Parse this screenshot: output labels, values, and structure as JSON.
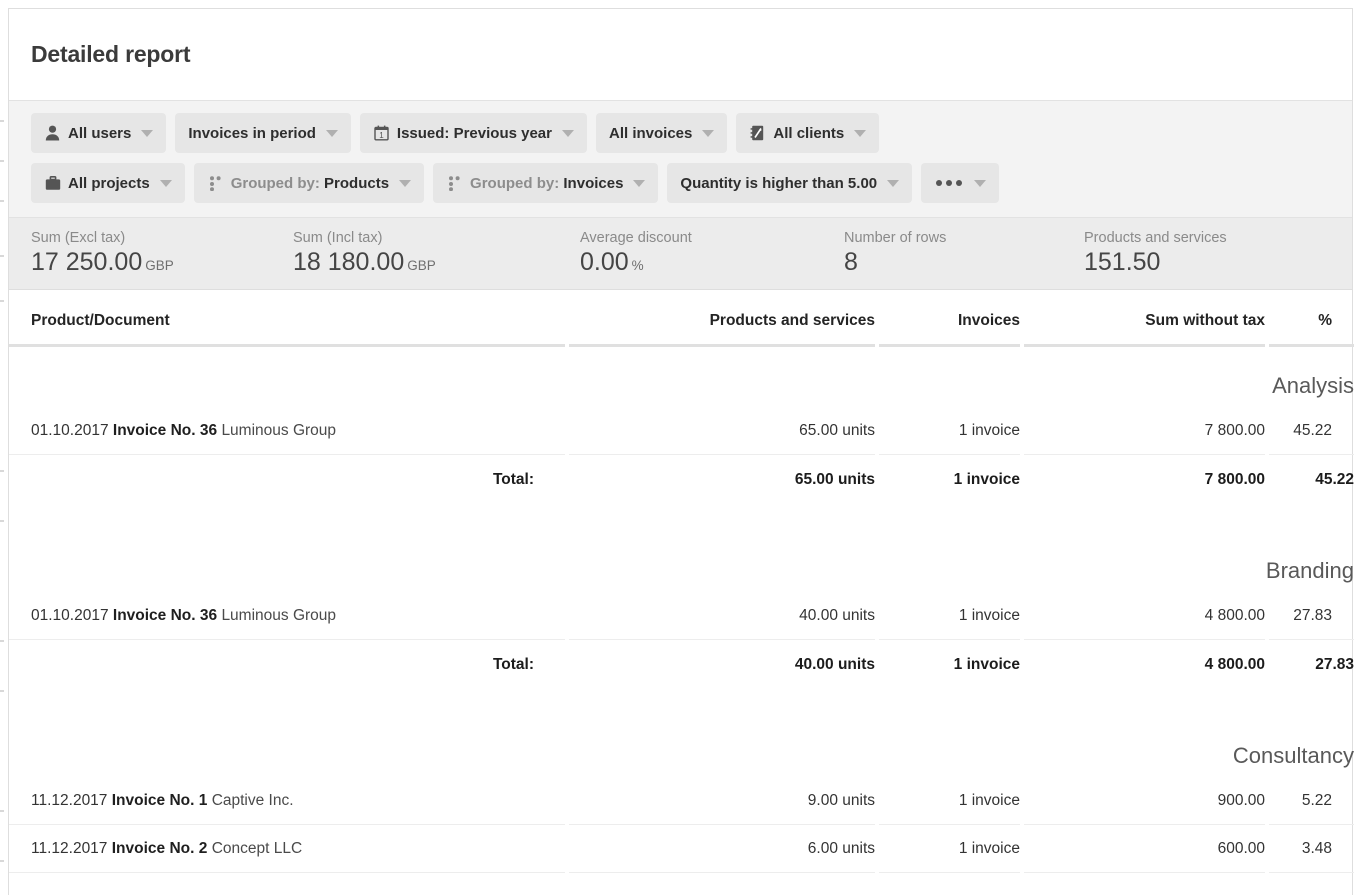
{
  "header": {
    "title": "Detailed report"
  },
  "filters": {
    "row1": [
      {
        "icon": "user-icon",
        "label": "All users",
        "muted_prefix": ""
      },
      {
        "icon": null,
        "label": "Invoices in period",
        "muted_prefix": ""
      },
      {
        "icon": "calendar-icon",
        "label": "Issued: Previous year",
        "muted_prefix": ""
      },
      {
        "icon": null,
        "label": "All invoices",
        "muted_prefix": ""
      },
      {
        "icon": "addressbook-icon",
        "label": "All clients",
        "muted_prefix": ""
      }
    ],
    "row2": [
      {
        "icon": "briefcase-icon",
        "label": "All projects",
        "muted_prefix": ""
      },
      {
        "icon": "group-icon",
        "label": "Products",
        "muted_prefix": "Grouped by: "
      },
      {
        "icon": "group-icon",
        "label": "Invoices",
        "muted_prefix": "Grouped by: "
      },
      {
        "icon": null,
        "label": "Quantity is higher than 5.00",
        "muted_prefix": ""
      },
      {
        "icon": "ellipsis-icon",
        "label": "",
        "muted_prefix": ""
      }
    ]
  },
  "summary": [
    {
      "label": "Sum (Excl tax)",
      "value": "17 250.00",
      "unit": "GBP"
    },
    {
      "label": "Sum (Incl tax)",
      "value": "18 180.00",
      "unit": "GBP"
    },
    {
      "label": "Average discount",
      "value": "0.00",
      "unit": "%"
    },
    {
      "label": "Number of rows",
      "value": "8",
      "unit": ""
    },
    {
      "label": "Products and services",
      "value": "151.50",
      "unit": ""
    }
  ],
  "table": {
    "columns": [
      "Product/Document",
      "Products and services",
      "Invoices",
      "Sum without tax",
      "%"
    ],
    "total_label": "Total:",
    "groups": [
      {
        "name": "Analysis",
        "rows": [
          {
            "date": "01.10.2017",
            "doc": "Invoice No. 36",
            "client": "Luminous Group",
            "products": "65.00 units",
            "invoices": "1 invoice",
            "sum": "7 800.00",
            "pct": "45.22"
          }
        ],
        "total": {
          "products": "65.00 units",
          "invoices": "1 invoice",
          "sum": "7 800.00",
          "pct": "45.22"
        }
      },
      {
        "name": "Branding",
        "rows": [
          {
            "date": "01.10.2017",
            "doc": "Invoice No. 36",
            "client": "Luminous Group",
            "products": "40.00 units",
            "invoices": "1 invoice",
            "sum": "4 800.00",
            "pct": "27.83"
          }
        ],
        "total": {
          "products": "40.00 units",
          "invoices": "1 invoice",
          "sum": "4 800.00",
          "pct": "27.83"
        }
      },
      {
        "name": "Consultancy",
        "rows": [
          {
            "date": "11.12.2017",
            "doc": "Invoice No. 1",
            "client": "Captive Inc.",
            "products": "9.00 units",
            "invoices": "1 invoice",
            "sum": "900.00",
            "pct": "5.22"
          },
          {
            "date": "11.12.2017",
            "doc": "Invoice No. 2",
            "client": "Concept LLC",
            "products": "6.00 units",
            "invoices": "1 invoice",
            "sum": "600.00",
            "pct": "3.48"
          }
        ],
        "total": null
      }
    ]
  },
  "colors": {
    "filter_bar_bg": "#f3f3f3",
    "chip_bg": "#e6e6e6",
    "summary_bg": "#ececec",
    "title_color": "#3b3b3b",
    "muted_text": "#8a8a8a"
  }
}
